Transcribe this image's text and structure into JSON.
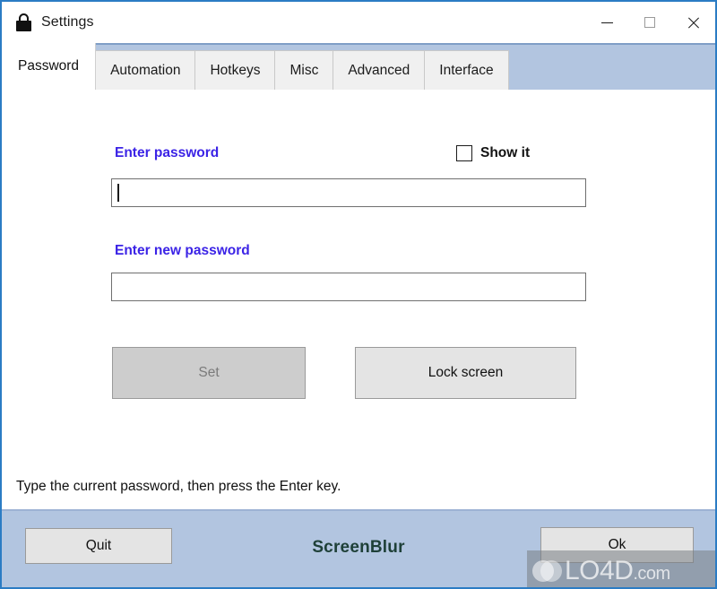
{
  "window": {
    "title": "Settings",
    "icon": "lock-icon",
    "border_color": "#2b7cc4",
    "controls": {
      "minimize": "─",
      "maximize": "□",
      "close": "✕"
    }
  },
  "tabs": [
    {
      "label": "Password",
      "active": true
    },
    {
      "label": "Automation",
      "active": false
    },
    {
      "label": "Hotkeys",
      "active": false
    },
    {
      "label": "Misc",
      "active": false
    },
    {
      "label": "Advanced",
      "active": false
    },
    {
      "label": "Interface",
      "active": false
    }
  ],
  "panel": {
    "password_label": "Enter password",
    "password_value": "",
    "new_password_label": "Enter new password",
    "new_password_value": "",
    "show_it_label": "Show it",
    "show_it_checked": false,
    "set_button": "Set",
    "set_button_enabled": false,
    "lock_screen_button": "Lock screen",
    "status_text": "Type the current password, then press the Enter key.",
    "label_color": "#3b23e6"
  },
  "footer": {
    "quit_button": "Quit",
    "brand": "ScreenBlur",
    "brand_color": "#1e4038",
    "ok_button": "Ok",
    "background_color": "#b2c5e0"
  },
  "watermark": {
    "text": "LO4D",
    "suffix": ".com"
  }
}
